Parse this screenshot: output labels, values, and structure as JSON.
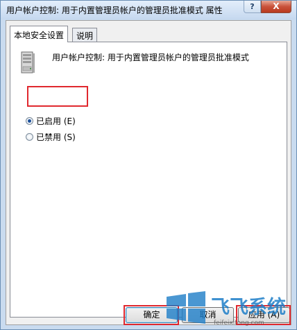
{
  "window": {
    "title": "用户帐户控制: 用于内置管理员帐户的管理员批准模式 属性",
    "help_label": "?",
    "close_label": "X"
  },
  "tabs": [
    {
      "label": "本地安全设置",
      "active": true
    },
    {
      "label": "说明",
      "active": false
    }
  ],
  "policy": {
    "title": "用户帐户控制: 用于内置管理员帐户的管理员批准模式",
    "icon": "server-policy-icon"
  },
  "options": [
    {
      "label": "已启用 (E)",
      "checked": true
    },
    {
      "label": "已禁用 (S)",
      "checked": false
    }
  ],
  "buttons": {
    "ok": "确定",
    "cancel": "取消",
    "apply": "应用 (A)"
  },
  "watermark": {
    "brand": "飞飞系统",
    "url": "feifeixitong.com"
  },
  "colors": {
    "highlight": "#e0282e",
    "title_bar": "#c5d8ef",
    "close_button": "#c9523a"
  }
}
